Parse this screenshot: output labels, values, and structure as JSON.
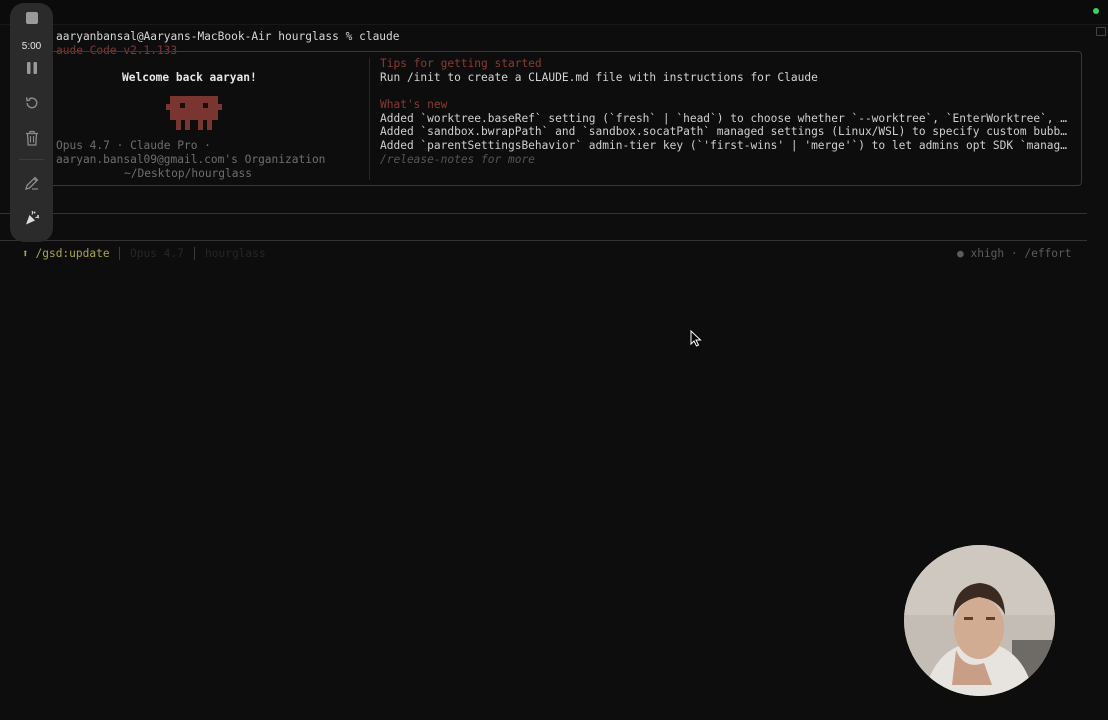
{
  "terminal": {
    "prompt_line": "aaryanbansal@Aaryans-MacBook-Air hourglass % claude",
    "version_line": "aude Code v2.1.133"
  },
  "welcome": {
    "title": "Welcome back aaryan!",
    "model_line": "Opus 4.7 · Claude Pro ·",
    "org_line": "aaryan.bansal09@gmail.com's Organization",
    "path_line": "~/Desktop/hourglass"
  },
  "tips": {
    "heading": "Tips for getting started",
    "text": "Run /init to create a CLAUDE.md file with instructions for Claude"
  },
  "whats_new": {
    "heading": "What's new",
    "items": [
      "Added `worktree.baseRef` setting (`fresh` | `head`) to choose whether `--worktree`, `EnterWorktree`, …",
      "Added `sandbox.bwrapPath` and `sandbox.socatPath` managed settings (Linux/WSL) to specify custom bubb…",
      "Added `parentSettingsBehavior` admin-tier key (`'first-wins' | 'merge'`) to let admins opt SDK `manag…"
    ],
    "release_note": "/release-notes for more"
  },
  "status_bar": {
    "update": "/gsd:update",
    "model": "Opus 4.7",
    "folder": "hourglass",
    "effort": "● xhigh · /effort"
  },
  "recorder": {
    "timer": "5:00",
    "icons": [
      "stop-icon",
      "pause-icon",
      "restart-icon",
      "trash-icon",
      "pen-icon",
      "confetti-icon"
    ]
  },
  "colors": {
    "accent": "#8a3a33",
    "update": "#a7a64a",
    "status_online": "#39d353"
  }
}
